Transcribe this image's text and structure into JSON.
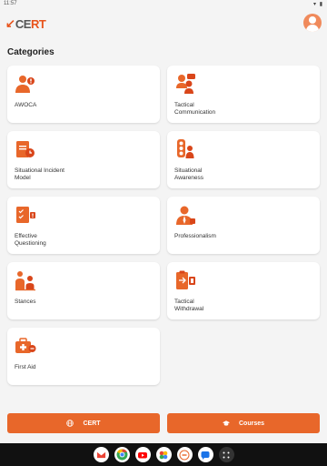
{
  "status": {
    "time": "11:57",
    "indicators": "▾ ▮"
  },
  "header": {
    "logo_prefix": "CE",
    "logo_suffix": "RT",
    "logo_mark": "↙"
  },
  "section_title": "Categories",
  "categories": [
    {
      "label": "AWOCA",
      "icon": "person-alert-icon"
    },
    {
      "label": "Tactical\nCommunication",
      "icon": "people-talking-icon"
    },
    {
      "label": "Situational Incident\nModel",
      "icon": "document-clock-icon"
    },
    {
      "label": "Situational\nAwareness",
      "icon": "traffic-light-person-icon"
    },
    {
      "label": "Effective\nQuestioning",
      "icon": "checklist-question-icon"
    },
    {
      "label": "Professionalism",
      "icon": "professional-person-icon"
    },
    {
      "label": "Stances",
      "icon": "stance-figure-icon"
    },
    {
      "label": "Tactical\nWithdrawal",
      "icon": "clipboard-exit-icon"
    },
    {
      "label": "First Aid",
      "icon": "first-aid-kit-icon"
    }
  ],
  "buttons": {
    "cert": "CERT",
    "courses": "Courses"
  },
  "colors": {
    "accent": "#e8672a",
    "accent_dark": "#d9461a"
  }
}
